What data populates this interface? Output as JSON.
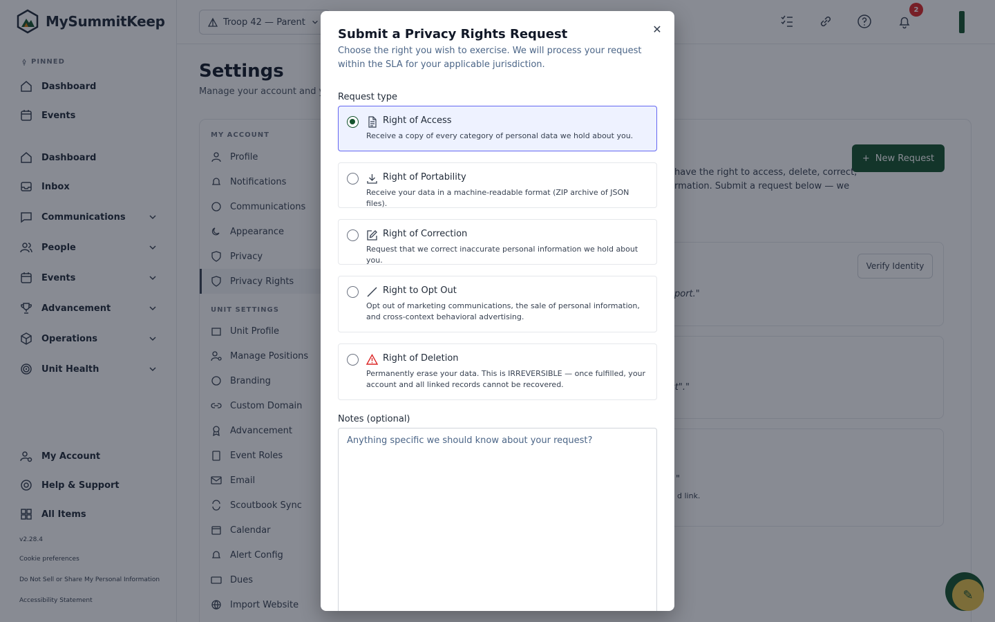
{
  "app": {
    "name": "MySummitKeep",
    "version": "v2.28.4"
  },
  "sidebar": {
    "pinned_label": "PINNED",
    "pinned": [
      {
        "label": "Dashboard",
        "icon": "home-icon"
      },
      {
        "label": "Events",
        "icon": "calendar-icon"
      }
    ],
    "items": [
      {
        "label": "Dashboard",
        "icon": "home-icon"
      },
      {
        "label": "Inbox",
        "icon": "inbox-icon"
      },
      {
        "label": "Communications",
        "icon": "chat-icon"
      },
      {
        "label": "People",
        "icon": "people-icon"
      },
      {
        "label": "Events",
        "icon": "calendar-icon"
      },
      {
        "label": "Advancement",
        "icon": "trophy-icon"
      },
      {
        "label": "Operations",
        "icon": "box-icon"
      },
      {
        "label": "Unit Health",
        "icon": "target-icon"
      }
    ],
    "bottom": [
      {
        "label": "My Account",
        "icon": "user-cog-icon"
      },
      {
        "label": "Help & Support",
        "icon": "lifebuoy-icon"
      },
      {
        "label": "All Items",
        "icon": "grid-icon"
      }
    ],
    "footer_links": [
      "Cookie preferences",
      "Do Not Sell or Share My Personal Information",
      "Accessibility Statement"
    ]
  },
  "topbar": {
    "unit_select": "Troop 42 — Parent",
    "notification_count": "2"
  },
  "settings": {
    "title": "Settings",
    "subtitle": "Manage your account and you",
    "my_account_label": "MY ACCOUNT",
    "my_account_items": [
      "Profile",
      "Notifications",
      "Communications",
      "Appearance",
      "Privacy",
      "Privacy Rights"
    ],
    "unit_settings_label": "UNIT SETTINGS",
    "unit_items": [
      "Unit Profile",
      "Manage Positions",
      "Branding",
      "Custom Domain",
      "Advancement",
      "Event Roles",
      "Email",
      "Scoutbook Sync",
      "Calendar",
      "Alert Config",
      "Dues",
      "Import Website"
    ],
    "new_request": "New Request",
    "intro_line1": "have the right to access, delete, correct,",
    "intro_line2": "rmation. Submit a request below — we",
    "verify_identity": "Verify Identity",
    "snippet1": "port.\"",
    "snippet2": "st\".\"",
    "snippet3": "\"",
    "snippet4": "d link."
  },
  "modal": {
    "title": "Submit a Privacy Rights Request",
    "description": "Choose the right you wish to exercise. We will process your request within the SLA for your applicable jurisdiction.",
    "request_type_label": "Request type",
    "options": [
      {
        "title": "Right of Access",
        "desc": "Receive a copy of every category of personal data we hold about you.",
        "icon": "document-icon",
        "selected": true
      },
      {
        "title": "Right of Portability",
        "desc": "Receive your data in a machine-readable format (ZIP archive of JSON files).",
        "icon": "download-icon",
        "selected": false
      },
      {
        "title": "Right of Correction",
        "desc": "Request that we correct inaccurate personal information we hold about you.",
        "icon": "edit-icon",
        "selected": false
      },
      {
        "title": "Right to Opt Out",
        "desc": "Opt out of marketing communications, the sale of personal information, and cross-context behavioral advertising.",
        "icon": "slash-icon",
        "selected": false
      },
      {
        "title": "Right of Deletion",
        "desc": "Permanently erase your data. This is IRREVERSIBLE — once fulfilled, your account and all linked records cannot be recovered.",
        "icon": "warning-icon",
        "selected": false
      }
    ],
    "notes_label": "Notes (optional)",
    "notes_placeholder": "Anything specific we should know about your request?",
    "notes_value": ""
  },
  "colors": {
    "brand": "#14532d",
    "selected_border": "#6366f1",
    "selected_bg": "#eef2ff",
    "danger": "#dc2626"
  }
}
